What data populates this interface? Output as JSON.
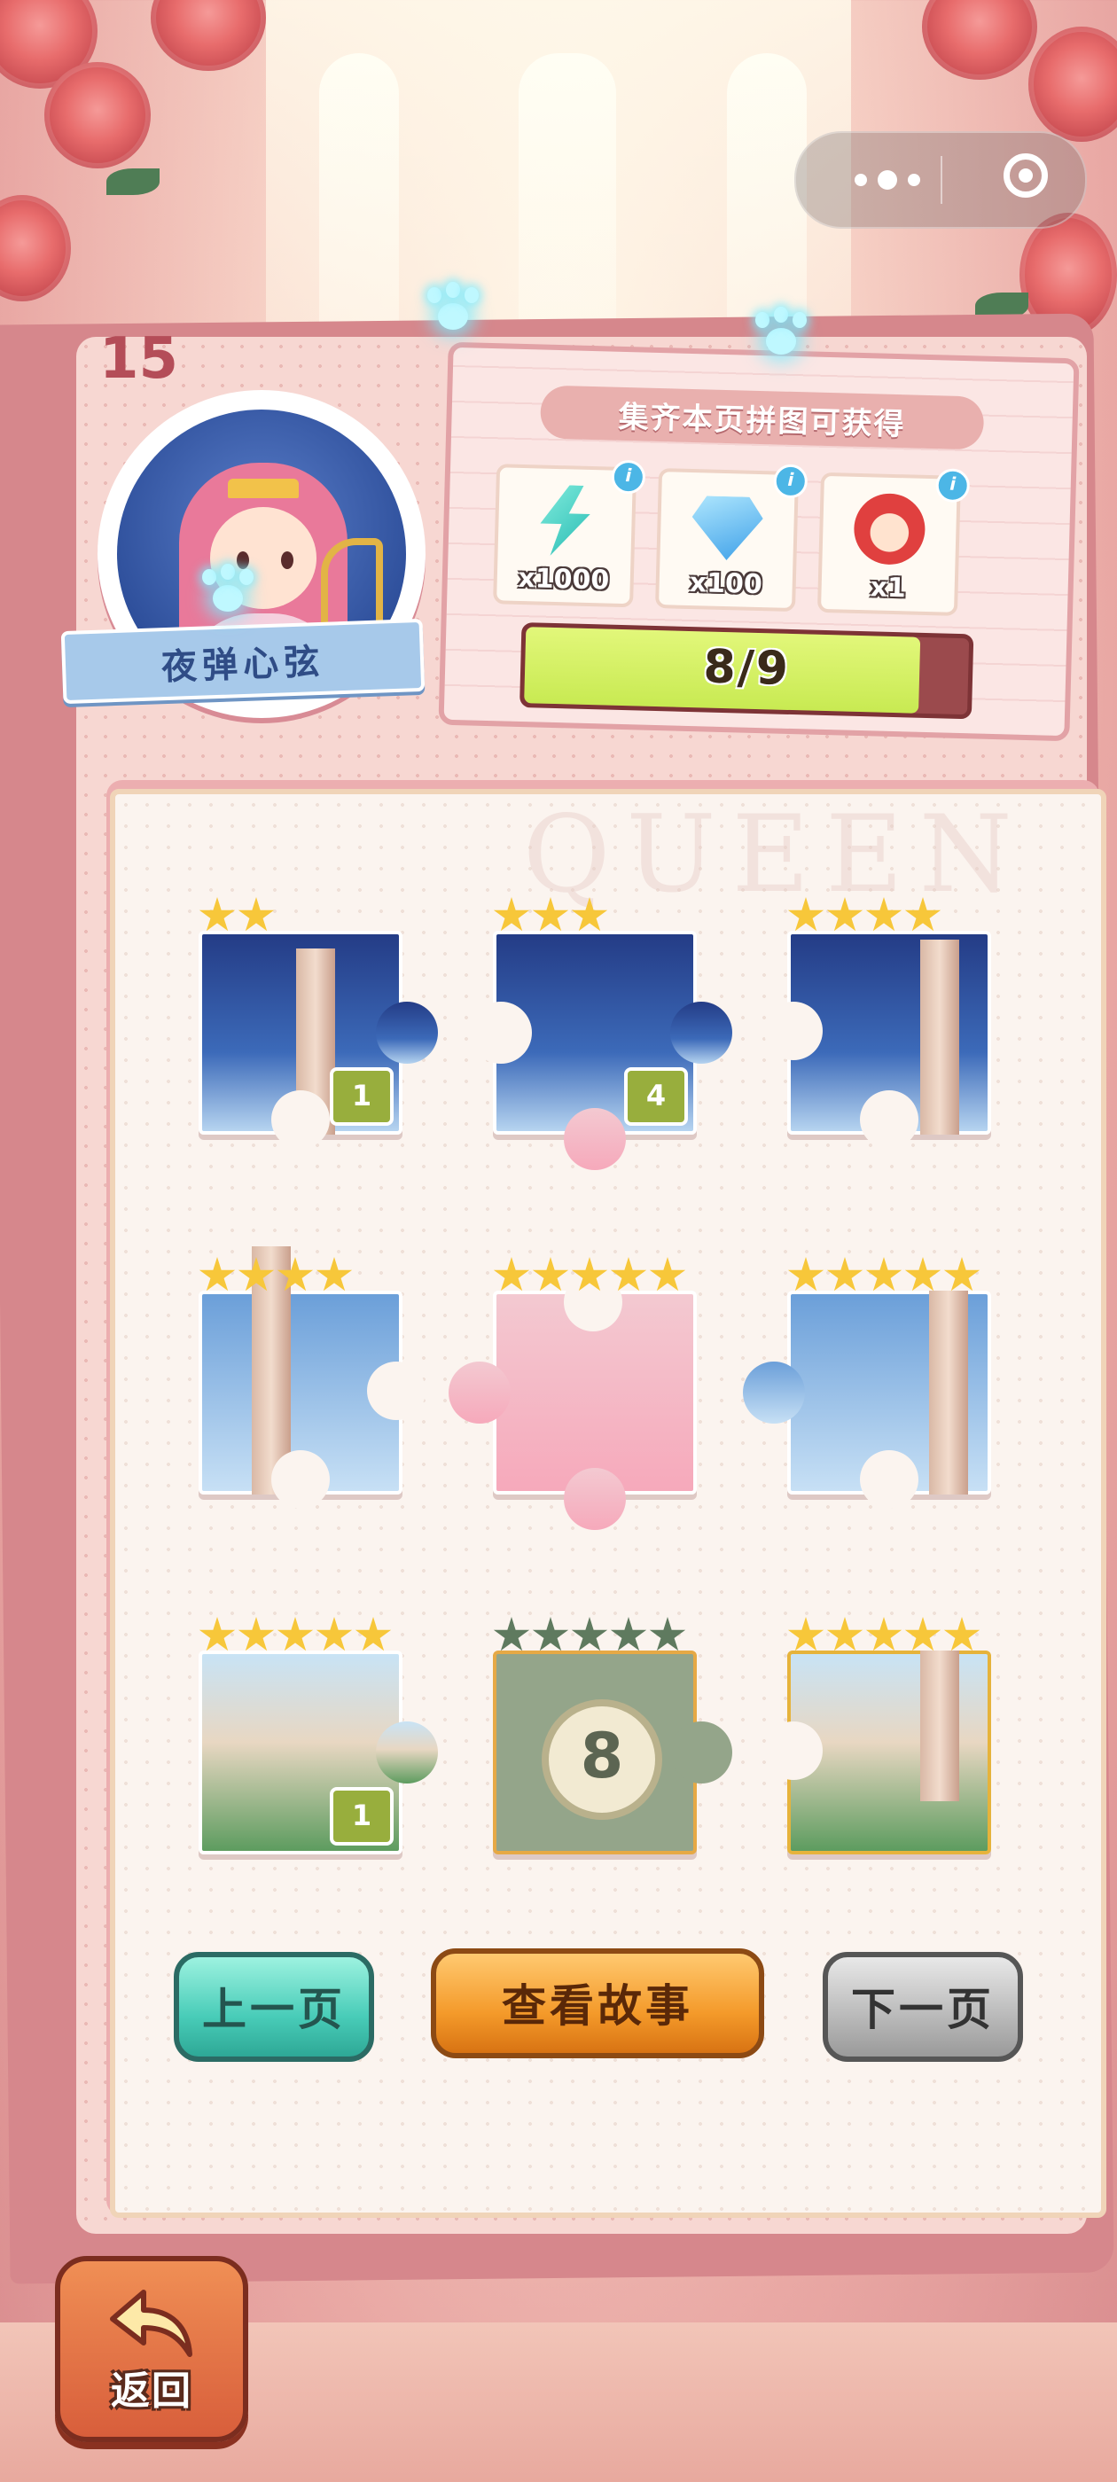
{
  "page_number": "15",
  "character": {
    "name": "夜弹心弦"
  },
  "reward": {
    "title": "集齐本页拼图可获得",
    "items": [
      {
        "icon": "lightning-bolt-icon",
        "qty": "x1000"
      },
      {
        "icon": "diamond-icon",
        "qty": "x100"
      },
      {
        "icon": "jester-character-icon",
        "qty": "x1"
      }
    ],
    "progress_text": "8/9",
    "progress_fraction": 0.889
  },
  "watermark": "QUEEN",
  "pieces": [
    {
      "stars": 2,
      "count": "1",
      "locked": false
    },
    {
      "stars": 3,
      "count": "4",
      "locked": false
    },
    {
      "stars": 4,
      "count": "",
      "locked": false
    },
    {
      "stars": 4,
      "count": "",
      "locked": false
    },
    {
      "stars": 5,
      "count": "",
      "locked": false
    },
    {
      "stars": 5,
      "count": "",
      "locked": false
    },
    {
      "stars": 5,
      "count": "1",
      "locked": false
    },
    {
      "stars": 5,
      "count": "",
      "locked": true,
      "locked_number": "8"
    },
    {
      "stars": 5,
      "count": "",
      "locked": false
    }
  ],
  "buttons": {
    "prev": "上一页",
    "story": "查看故事",
    "next": "下一页",
    "back": "返回"
  },
  "colors": {
    "star": "#f7c73a",
    "locked_star": "#5f7a5f",
    "progress_fill": "#c8ea52",
    "count_badge": "#98ae3d"
  }
}
